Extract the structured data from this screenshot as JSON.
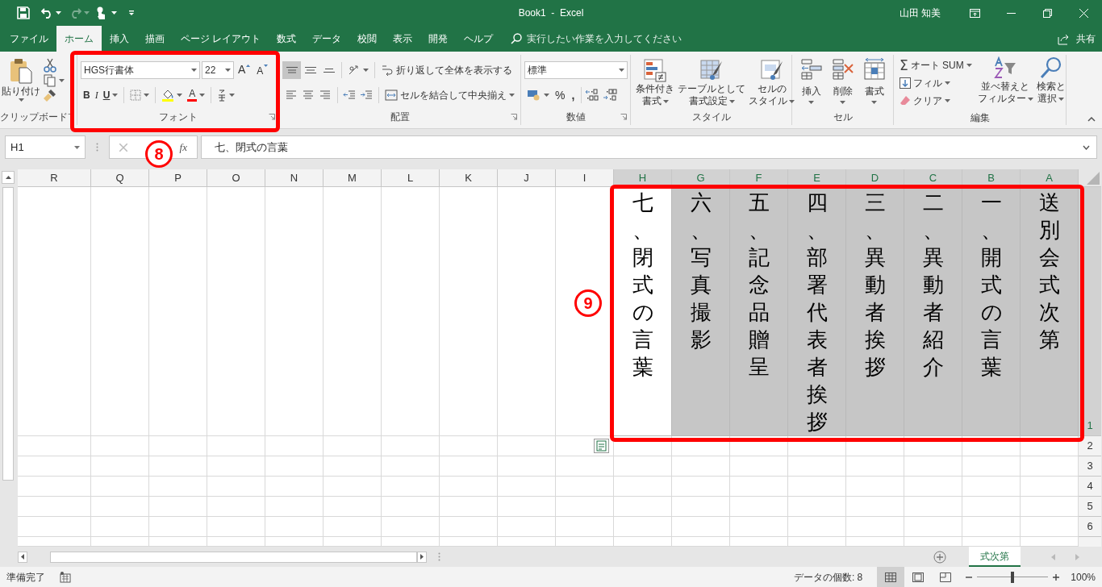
{
  "title_bar": {
    "title": "Book1  -  Excel",
    "user": "山田 知美"
  },
  "tabs": [
    {
      "label": "ファイル",
      "selected": false
    },
    {
      "label": "ホーム",
      "selected": true
    },
    {
      "label": "挿入",
      "selected": false
    },
    {
      "label": "描画",
      "selected": false
    },
    {
      "label": "ページ レイアウト",
      "selected": false
    },
    {
      "label": "数式",
      "selected": false
    },
    {
      "label": "データ",
      "selected": false
    },
    {
      "label": "校閲",
      "selected": false
    },
    {
      "label": "表示",
      "selected": false
    },
    {
      "label": "開発",
      "selected": false
    },
    {
      "label": "ヘルプ",
      "selected": false
    }
  ],
  "tell_me": {
    "placeholder": "実行したい作業を入力してください"
  },
  "share": "共有",
  "ribbon": {
    "clipboard": {
      "label": "クリップボード",
      "paste": "貼り付け"
    },
    "font": {
      "label": "フォント",
      "font_name": "HGS行書体",
      "font_size": "22",
      "grow": "A",
      "shrink": "A",
      "bold": "B",
      "italic": "I",
      "underline": "U",
      "font_color": "A"
    },
    "alignment": {
      "label": "配置",
      "vertical_align": [
        {
          "selected": true
        },
        {
          "selected": false
        },
        {
          "selected": false
        }
      ],
      "wrap_text": "折り返して全体を表示する",
      "merge": "セルを結合して中央揃え"
    },
    "number": {
      "label": "数値",
      "format": "標準",
      "percent": "%",
      "comma": ","
    },
    "styles": {
      "label": "スタイル",
      "buttons": [
        {
          "lines": [
            "条件付き",
            "書式"
          ]
        },
        {
          "lines": [
            "テーブルとして",
            "書式設定"
          ]
        },
        {
          "lines": [
            "セルの",
            "スタイル"
          ]
        }
      ]
    },
    "cells": {
      "label": "セル",
      "buttons": [
        "挿入",
        "削除",
        "書式"
      ]
    },
    "editing": {
      "label": "編集",
      "autosum_glyph": "Σ",
      "autosum": "オート SUM",
      "fill": "フィル",
      "clear": "クリア",
      "sort_filter": [
        "並べ替えと",
        "フィルター"
      ],
      "find_select": [
        "検索と",
        "選択"
      ]
    }
  },
  "formula_bar": {
    "name_box": "H1",
    "function_label": "fx",
    "formula": "七、閉式の言葉"
  },
  "columns": [
    {
      "label": "R",
      "selected": false
    },
    {
      "label": "Q",
      "selected": false
    },
    {
      "label": "P",
      "selected": false
    },
    {
      "label": "O",
      "selected": false
    },
    {
      "label": "N",
      "selected": false
    },
    {
      "label": "M",
      "selected": false
    },
    {
      "label": "L",
      "selected": false
    },
    {
      "label": "K",
      "selected": false
    },
    {
      "label": "J",
      "selected": false
    },
    {
      "label": "I",
      "selected": false
    },
    {
      "label": "H",
      "selected": true
    },
    {
      "label": "G",
      "selected": true
    },
    {
      "label": "F",
      "selected": true
    },
    {
      "label": "E",
      "selected": true
    },
    {
      "label": "D",
      "selected": true
    },
    {
      "label": "C",
      "selected": true
    },
    {
      "label": "B",
      "selected": true
    },
    {
      "label": "A",
      "selected": true
    }
  ],
  "rows": [
    {
      "label": "1",
      "selected": true
    },
    {
      "label": "2",
      "selected": false
    },
    {
      "label": "3",
      "selected": false
    },
    {
      "label": "4",
      "selected": false
    },
    {
      "label": "5",
      "selected": false
    },
    {
      "label": "6",
      "selected": false
    }
  ],
  "row_1_cells": [
    {
      "text": "七、閉式の言葉",
      "active": true
    },
    {
      "text": "六、写真撮影",
      "active": false
    },
    {
      "text": "五、記念品贈呈",
      "active": false
    },
    {
      "text": "四、部署代表者挨拶",
      "active": false
    },
    {
      "text": "三、異動者挨拶",
      "active": false
    },
    {
      "text": "二、異動者紹介",
      "active": false
    },
    {
      "text": "一、開式の言葉",
      "active": false
    },
    {
      "text": "送別会式次第",
      "active": false
    }
  ],
  "sheet_tabs": [
    {
      "label": "式次第",
      "selected": true
    }
  ],
  "status_bar": {
    "ready": "準備完了",
    "count": "データの個数: 8",
    "views": [
      {
        "selected": true
      },
      {
        "selected": false
      },
      {
        "selected": false
      }
    ],
    "zoom": {
      "level": 0.5,
      "reading": "100%"
    }
  },
  "annotations": [
    {
      "label": "8"
    },
    {
      "label": "9"
    }
  ]
}
